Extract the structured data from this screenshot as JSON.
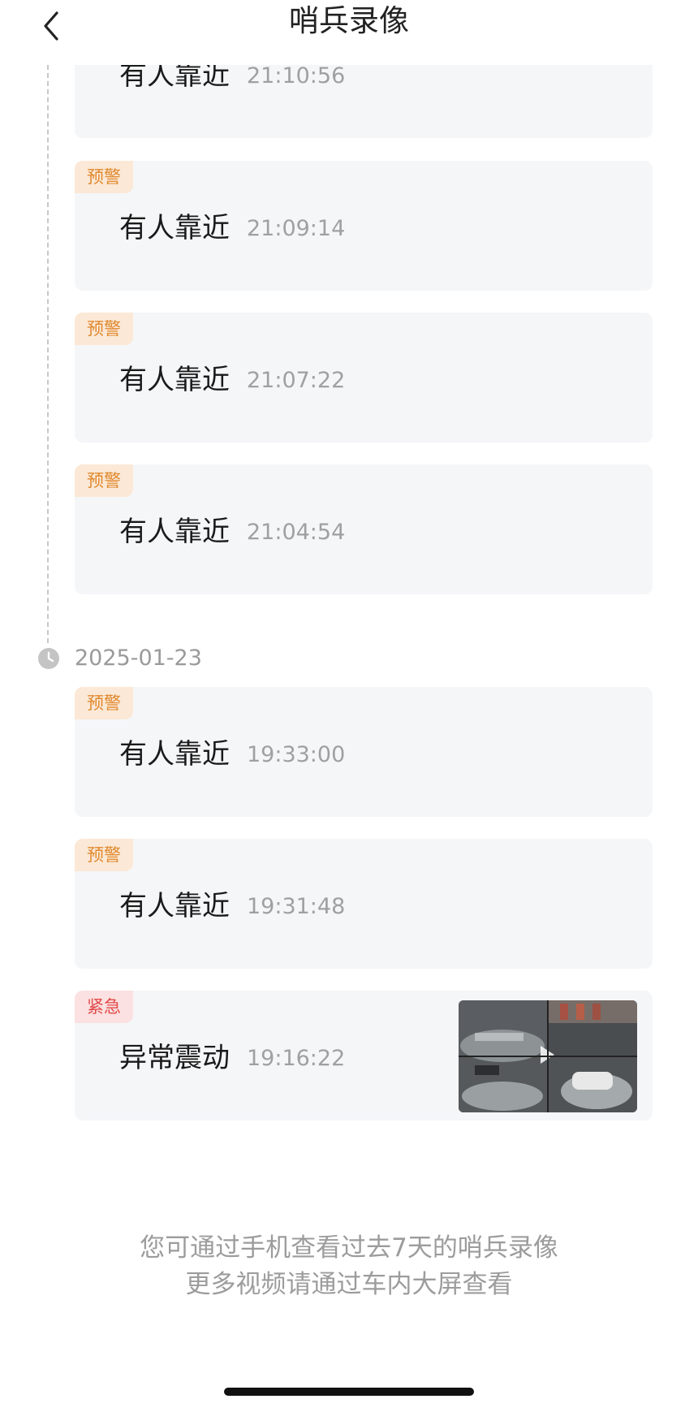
{
  "header": {
    "title": "哨兵录像",
    "back_icon": "chevron-left-icon"
  },
  "timeline": {
    "date": "2025-01-23",
    "date_icon": "clock-icon"
  },
  "records": [
    {
      "tag": "",
      "event": "有人靠近",
      "time": "21:10:56"
    },
    {
      "tag": "预警",
      "event": "有人靠近",
      "time": "21:09:14"
    },
    {
      "tag": "预警",
      "event": "有人靠近",
      "time": "21:07:22"
    },
    {
      "tag": "预警",
      "event": "有人靠近",
      "time": "21:04:54"
    },
    {
      "tag": "预警",
      "event": "有人靠近",
      "time": "19:33:00"
    },
    {
      "tag": "预警",
      "event": "有人靠近",
      "time": "19:31:48"
    },
    {
      "tag": "紧急",
      "event": "异常震动",
      "time": "19:16:22"
    }
  ],
  "footer": {
    "line1": "您可通过手机查看过去7天的哨兵录像",
    "line2": "更多视频请通过车内大屏查看"
  },
  "colors": {
    "warn_tag_bg": "#fbe8d6",
    "warn_tag_text": "#e0892e",
    "urgent_tag_bg": "#fbe1e1",
    "urgent_tag_text": "#e24a4a",
    "card_bg": "#f5f6f8"
  }
}
